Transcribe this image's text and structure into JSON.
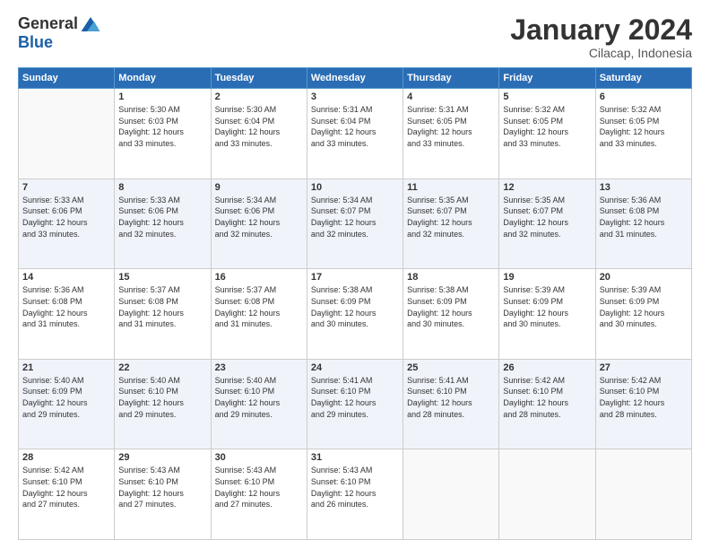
{
  "logo": {
    "general": "General",
    "blue": "Blue"
  },
  "title": "January 2024",
  "location": "Cilacap, Indonesia",
  "days_header": [
    "Sunday",
    "Monday",
    "Tuesday",
    "Wednesday",
    "Thursday",
    "Friday",
    "Saturday"
  ],
  "weeks": [
    [
      {
        "day": "",
        "info": ""
      },
      {
        "day": "1",
        "info": "Sunrise: 5:30 AM\nSunset: 6:03 PM\nDaylight: 12 hours\nand 33 minutes."
      },
      {
        "day": "2",
        "info": "Sunrise: 5:30 AM\nSunset: 6:04 PM\nDaylight: 12 hours\nand 33 minutes."
      },
      {
        "day": "3",
        "info": "Sunrise: 5:31 AM\nSunset: 6:04 PM\nDaylight: 12 hours\nand 33 minutes."
      },
      {
        "day": "4",
        "info": "Sunrise: 5:31 AM\nSunset: 6:05 PM\nDaylight: 12 hours\nand 33 minutes."
      },
      {
        "day": "5",
        "info": "Sunrise: 5:32 AM\nSunset: 6:05 PM\nDaylight: 12 hours\nand 33 minutes."
      },
      {
        "day": "6",
        "info": "Sunrise: 5:32 AM\nSunset: 6:05 PM\nDaylight: 12 hours\nand 33 minutes."
      }
    ],
    [
      {
        "day": "7",
        "info": "Sunrise: 5:33 AM\nSunset: 6:06 PM\nDaylight: 12 hours\nand 33 minutes."
      },
      {
        "day": "8",
        "info": "Sunrise: 5:33 AM\nSunset: 6:06 PM\nDaylight: 12 hours\nand 32 minutes."
      },
      {
        "day": "9",
        "info": "Sunrise: 5:34 AM\nSunset: 6:06 PM\nDaylight: 12 hours\nand 32 minutes."
      },
      {
        "day": "10",
        "info": "Sunrise: 5:34 AM\nSunset: 6:07 PM\nDaylight: 12 hours\nand 32 minutes."
      },
      {
        "day": "11",
        "info": "Sunrise: 5:35 AM\nSunset: 6:07 PM\nDaylight: 12 hours\nand 32 minutes."
      },
      {
        "day": "12",
        "info": "Sunrise: 5:35 AM\nSunset: 6:07 PM\nDaylight: 12 hours\nand 32 minutes."
      },
      {
        "day": "13",
        "info": "Sunrise: 5:36 AM\nSunset: 6:08 PM\nDaylight: 12 hours\nand 31 minutes."
      }
    ],
    [
      {
        "day": "14",
        "info": "Sunrise: 5:36 AM\nSunset: 6:08 PM\nDaylight: 12 hours\nand 31 minutes."
      },
      {
        "day": "15",
        "info": "Sunrise: 5:37 AM\nSunset: 6:08 PM\nDaylight: 12 hours\nand 31 minutes."
      },
      {
        "day": "16",
        "info": "Sunrise: 5:37 AM\nSunset: 6:08 PM\nDaylight: 12 hours\nand 31 minutes."
      },
      {
        "day": "17",
        "info": "Sunrise: 5:38 AM\nSunset: 6:09 PM\nDaylight: 12 hours\nand 30 minutes."
      },
      {
        "day": "18",
        "info": "Sunrise: 5:38 AM\nSunset: 6:09 PM\nDaylight: 12 hours\nand 30 minutes."
      },
      {
        "day": "19",
        "info": "Sunrise: 5:39 AM\nSunset: 6:09 PM\nDaylight: 12 hours\nand 30 minutes."
      },
      {
        "day": "20",
        "info": "Sunrise: 5:39 AM\nSunset: 6:09 PM\nDaylight: 12 hours\nand 30 minutes."
      }
    ],
    [
      {
        "day": "21",
        "info": "Sunrise: 5:40 AM\nSunset: 6:09 PM\nDaylight: 12 hours\nand 29 minutes."
      },
      {
        "day": "22",
        "info": "Sunrise: 5:40 AM\nSunset: 6:10 PM\nDaylight: 12 hours\nand 29 minutes."
      },
      {
        "day": "23",
        "info": "Sunrise: 5:40 AM\nSunset: 6:10 PM\nDaylight: 12 hours\nand 29 minutes."
      },
      {
        "day": "24",
        "info": "Sunrise: 5:41 AM\nSunset: 6:10 PM\nDaylight: 12 hours\nand 29 minutes."
      },
      {
        "day": "25",
        "info": "Sunrise: 5:41 AM\nSunset: 6:10 PM\nDaylight: 12 hours\nand 28 minutes."
      },
      {
        "day": "26",
        "info": "Sunrise: 5:42 AM\nSunset: 6:10 PM\nDaylight: 12 hours\nand 28 minutes."
      },
      {
        "day": "27",
        "info": "Sunrise: 5:42 AM\nSunset: 6:10 PM\nDaylight: 12 hours\nand 28 minutes."
      }
    ],
    [
      {
        "day": "28",
        "info": "Sunrise: 5:42 AM\nSunset: 6:10 PM\nDaylight: 12 hours\nand 27 minutes."
      },
      {
        "day": "29",
        "info": "Sunrise: 5:43 AM\nSunset: 6:10 PM\nDaylight: 12 hours\nand 27 minutes."
      },
      {
        "day": "30",
        "info": "Sunrise: 5:43 AM\nSunset: 6:10 PM\nDaylight: 12 hours\nand 27 minutes."
      },
      {
        "day": "31",
        "info": "Sunrise: 5:43 AM\nSunset: 6:10 PM\nDaylight: 12 hours\nand 26 minutes."
      },
      {
        "day": "",
        "info": ""
      },
      {
        "day": "",
        "info": ""
      },
      {
        "day": "",
        "info": ""
      }
    ]
  ]
}
